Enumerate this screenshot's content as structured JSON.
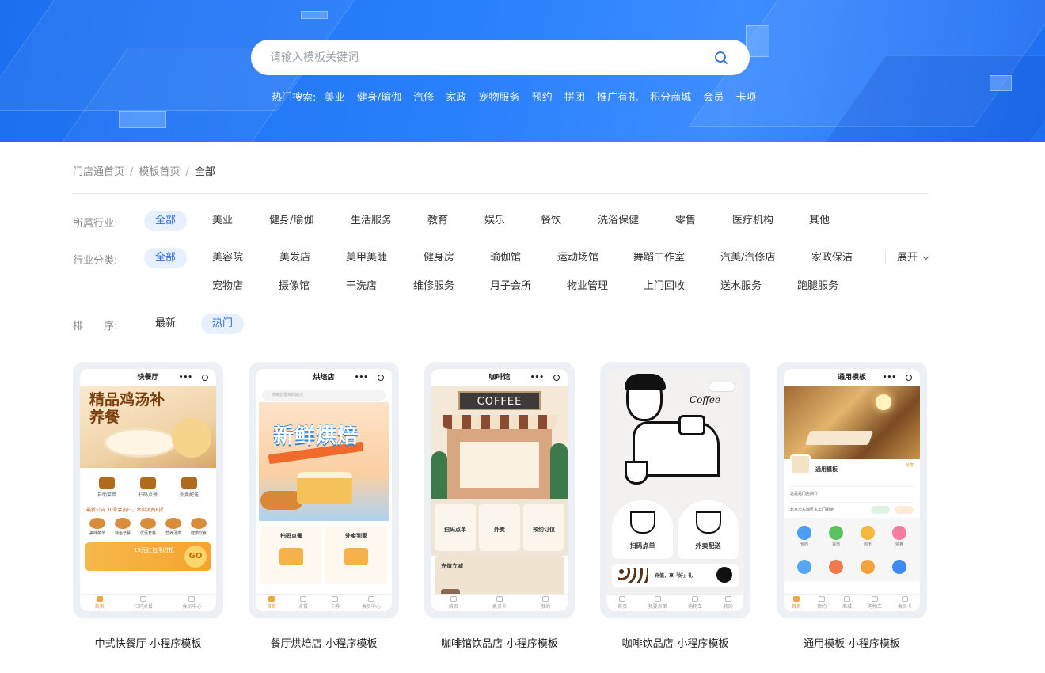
{
  "search": {
    "placeholder": "请输入模板关键词",
    "hot_label": "热门搜索:",
    "hot_items": [
      "美业",
      "健身/瑜伽",
      "汽修",
      "家政",
      "宠物服务",
      "预约",
      "拼团",
      "推广有礼",
      "积分商城",
      "会员",
      "卡项"
    ]
  },
  "breadcrumb": {
    "items": [
      "门店通首页",
      "模板首页"
    ],
    "separator": "/",
    "current": "全部"
  },
  "filters": {
    "industry": {
      "label": "所属行业:",
      "options": [
        "全部",
        "美业",
        "健身/瑜伽",
        "生活服务",
        "教育",
        "娱乐",
        "餐饮",
        "洗浴保健",
        "零售",
        "医疗机构",
        "其他"
      ],
      "selected": "全部"
    },
    "category": {
      "label": "行业分类:",
      "options_row1": [
        "全部",
        "美容院",
        "美发店",
        "美甲美睫",
        "健身房",
        "瑜伽馆",
        "运动场馆",
        "舞蹈工作室",
        "汽美/汽修店",
        "家政保洁"
      ],
      "options_row2": [
        "宠物店",
        "摄像馆",
        "干洗店",
        "维修服务",
        "月子会所",
        "物业管理",
        "上门回收",
        "送水服务",
        "跑腿服务"
      ],
      "selected": "全部",
      "expand_label": "展开"
    },
    "sort": {
      "label": "排　　序:",
      "options": [
        "最新",
        "热门"
      ],
      "selected": "热门"
    }
  },
  "templates": [
    {
      "title": "中式快餐厅-小程序模板",
      "phone_title": "快餐厅",
      "banner_text": "精品鸡汤补养餐",
      "icons": [
        "自助菜单",
        "扫码点餐",
        "外卖配送"
      ],
      "notice": "最新公告  30号会员日，本店消费8折",
      "foods": [
        "美味菜单",
        "特色套餐",
        "优惠套餐",
        "营养汤类",
        "健康饮食"
      ],
      "coupon_text": "15元红包限时抢",
      "coupon_go": "GO",
      "tabs": [
        "首页",
        "扫码点餐",
        "会员中心"
      ]
    },
    {
      "title": "餐厅烘焙店-小程序模板",
      "phone_title": "烘焙店",
      "search_hint": "搜索您喜欢的面点",
      "banner_text": "新鲜烘焙",
      "cards": [
        "扫码点餐",
        "外卖到家"
      ],
      "tabs": [
        "首页",
        "点餐",
        "卡券",
        "会员中心"
      ]
    },
    {
      "title": "咖啡馆饮品店-小程序模板",
      "phone_title": "咖啡馆",
      "sign_text": "COFFEE",
      "cards": [
        "扫码点单",
        "外卖",
        "预约订位"
      ],
      "charge_title": "充值立减",
      "tabs": [
        "首页",
        "会员卡",
        "我的"
      ]
    },
    {
      "title": "咖啡饮品店-小程序模板",
      "art_word": "Coffee",
      "cards": [
        "扫码点单",
        "外卖配送"
      ],
      "promo_text": "充值，享「好」礼",
      "tabs": [
        "首页",
        "我要点单",
        "购物车",
        "我的"
      ]
    },
    {
      "title": "通用模板-小程序模板",
      "phone_title": "通用模板",
      "shop_name": "通用模板",
      "share": "分享",
      "intro_line": "这是是门店简介",
      "address_line": "北京市东城区东华门街道",
      "grid": [
        "预约",
        "充值",
        "购卡",
        "领券",
        "",
        "",
        "",
        ""
      ],
      "tabs": [
        "首页",
        "预约",
        "商城",
        "购物车",
        "会员卡"
      ]
    }
  ],
  "colors": {
    "hero_blue": "#2a80fb",
    "accent": "#2f6fe0",
    "active_pill_bg": "#e8f0fd"
  }
}
